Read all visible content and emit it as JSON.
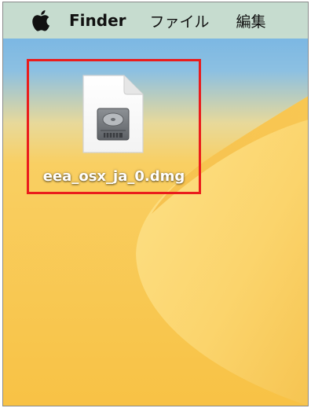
{
  "menubar": {
    "apple_icon": "apple-icon",
    "app_name": "Finder",
    "items": [
      {
        "label": "ファイル"
      },
      {
        "label": "編集"
      }
    ],
    "background": "#cde0cd"
  },
  "desktop": {
    "wallpaper": "macOS Ventura",
    "colors": {
      "sky": "#74b4e4",
      "sand": "#f8c95a",
      "dune_light": "#fbd775"
    },
    "file": {
      "name": "eea_osx_ja_0.dmg",
      "icon": "disk-image-icon",
      "selected": true,
      "highlight_color": "#ea1c1c"
    }
  }
}
